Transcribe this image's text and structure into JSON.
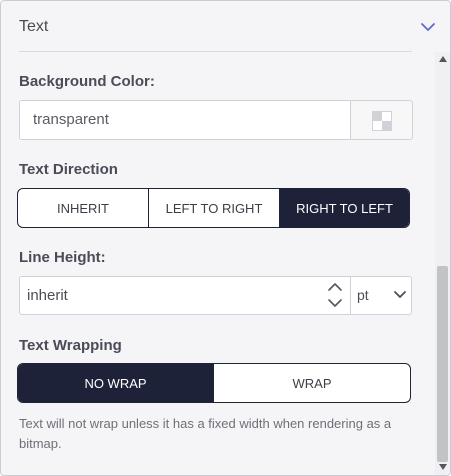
{
  "header": {
    "title": "Text"
  },
  "background_color": {
    "label": "Background Color:",
    "value": "transparent"
  },
  "text_direction": {
    "label": "Text Direction",
    "options": [
      "INHERIT",
      "LEFT TO RIGHT",
      "RIGHT TO LEFT"
    ],
    "selected": "RIGHT TO LEFT"
  },
  "line_height": {
    "label": "Line Height:",
    "value": "inherit",
    "unit": "pt"
  },
  "text_wrapping": {
    "label": "Text Wrapping",
    "options": [
      "NO WRAP",
      "WRAP"
    ],
    "selected": "NO WRAP",
    "help": "Text will not wrap unless it has a fixed width when rendering as a bitmap."
  },
  "colors": {
    "accent_dark": "#1d2238",
    "chevron_blue": "#5b6bd0",
    "panel_bg": "#f5f5f7"
  },
  "icons": [
    "chevron-down-icon",
    "checkerboard-swatch-icon",
    "stepper-up-icon",
    "stepper-down-icon",
    "scroll-up-icon",
    "scroll-down-icon"
  ]
}
